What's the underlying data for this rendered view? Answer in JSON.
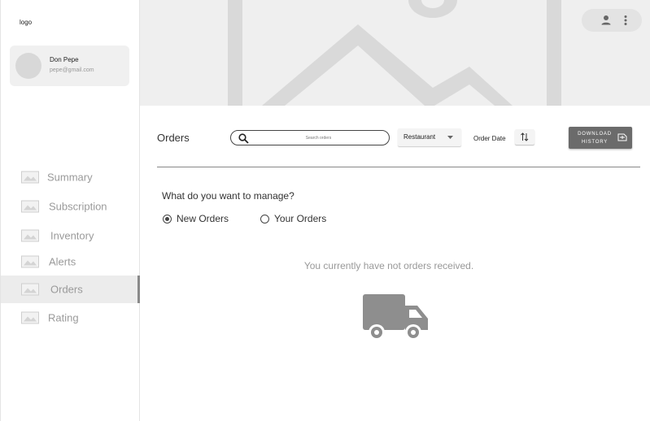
{
  "sidebar": {
    "logo": "logo",
    "user": {
      "name": "Don Pepe",
      "email": "pepe@gmail.com"
    },
    "items": [
      {
        "label": "Summary",
        "icon": "image-placeholder-icon"
      },
      {
        "label": "Subscription",
        "icon": "image-placeholder-icon"
      },
      {
        "label": "Inventory",
        "icon": "image-placeholder-icon"
      },
      {
        "label": "Alerts",
        "icon": "image-placeholder-icon"
      },
      {
        "label": "Orders",
        "icon": "image-placeholder-icon",
        "active": true
      },
      {
        "label": "Rating",
        "icon": "image-placeholder-icon"
      }
    ]
  },
  "header": {
    "banner": "image-placeholder",
    "actions": [
      "person-icon",
      "more-vert-icon"
    ]
  },
  "toolbar": {
    "title": "Orders",
    "search_placeholder": "Search orders",
    "filter_value": "Restaurant",
    "sort_label": "Order Date",
    "download_label": "DOWNLOAD HISTORY"
  },
  "manage": {
    "question": "What do you want to manage?",
    "options": [
      {
        "label": "New Orders",
        "selected": true
      },
      {
        "label": "Your Orders",
        "selected": false
      }
    ]
  },
  "empty_state": {
    "message": "You currently have not orders received.",
    "icon": "truck-icon"
  },
  "colors": {
    "accent": "#6b6b6b",
    "placeholder": "#d4d4d4",
    "sidebar_active": "#ececec"
  }
}
